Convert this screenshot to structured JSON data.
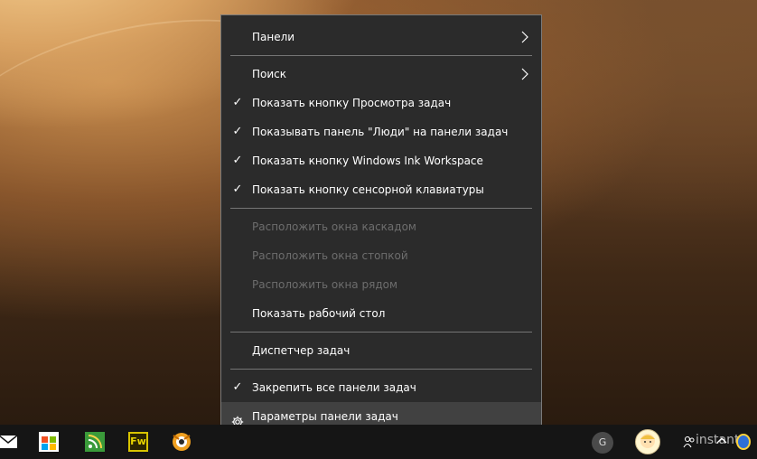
{
  "colors": {
    "menu_bg": "#2b2b2b",
    "menu_border": "#7a7a7a",
    "highlight_bg": "#414141",
    "disabled_text": "#6d6d6d",
    "taskbar_bg": "#151515"
  },
  "context_menu": {
    "items": [
      {
        "label": "Панели",
        "has_submenu": true
      },
      {
        "label": "Поиск",
        "has_submenu": true
      },
      {
        "label": "Показать кнопку Просмотра задач",
        "checked": true
      },
      {
        "label": "Показывать панель \"Люди\" на панели задач",
        "checked": true
      },
      {
        "label": "Показать кнопку Windows Ink Workspace",
        "checked": true
      },
      {
        "label": "Показать кнопку сенсорной клавиатуры",
        "checked": true
      },
      {
        "label": "Расположить окна каскадом",
        "disabled": true
      },
      {
        "label": "Расположить окна стопкой",
        "disabled": true
      },
      {
        "label": "Расположить окна рядом",
        "disabled": true
      },
      {
        "label": "Показать рабочий стол"
      },
      {
        "label": "Диспетчер задач"
      },
      {
        "label": "Закрепить все панели задач",
        "checked": true
      },
      {
        "label": "Параметры панели задач",
        "icon": "gear-icon",
        "highlighted": true
      }
    ],
    "check_glyph": "✓"
  },
  "taskbar": {
    "pinned_icons": [
      "mail-icon",
      "store-icon",
      "feed-reader-icon",
      "fireworks-icon",
      "xnview-icon"
    ],
    "fw_label": "Fw",
    "tray": {
      "account_letter": "G",
      "icons": [
        "account-icon",
        "avatar-icon",
        "people-icon",
        "chevron-up-icon",
        "bulb-icon"
      ],
      "watermark": "instant"
    }
  }
}
